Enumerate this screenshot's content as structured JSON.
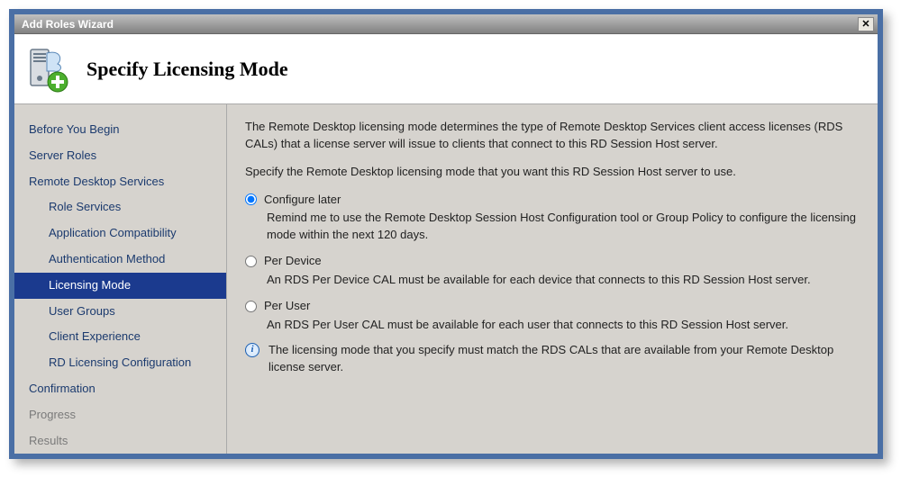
{
  "window": {
    "title": "Add Roles Wizard",
    "close": "✕"
  },
  "header": {
    "title": "Specify Licensing Mode"
  },
  "sidebar": {
    "items": [
      {
        "label": "Before You Begin",
        "child": false,
        "selected": false,
        "disabled": false
      },
      {
        "label": "Server Roles",
        "child": false,
        "selected": false,
        "disabled": false
      },
      {
        "label": "Remote Desktop Services",
        "child": false,
        "selected": false,
        "disabled": false
      },
      {
        "label": "Role Services",
        "child": true,
        "selected": false,
        "disabled": false
      },
      {
        "label": "Application Compatibility",
        "child": true,
        "selected": false,
        "disabled": false
      },
      {
        "label": "Authentication Method",
        "child": true,
        "selected": false,
        "disabled": false
      },
      {
        "label": "Licensing Mode",
        "child": true,
        "selected": true,
        "disabled": false
      },
      {
        "label": "User Groups",
        "child": true,
        "selected": false,
        "disabled": false
      },
      {
        "label": "Client Experience",
        "child": true,
        "selected": false,
        "disabled": false
      },
      {
        "label": "RD Licensing Configuration",
        "child": true,
        "selected": false,
        "disabled": false
      },
      {
        "label": "Confirmation",
        "child": false,
        "selected": false,
        "disabled": false
      },
      {
        "label": "Progress",
        "child": false,
        "selected": false,
        "disabled": true
      },
      {
        "label": "Results",
        "child": false,
        "selected": false,
        "disabled": true
      }
    ]
  },
  "content": {
    "intro1": "The Remote Desktop licensing mode determines the type of Remote Desktop Services client access licenses (RDS CALs) that a license server will issue to clients that connect to this RD Session Host server.",
    "intro2": "Specify the Remote Desktop licensing mode that you want this RD Session Host server to use.",
    "options": [
      {
        "label": "Configure later",
        "desc": "Remind me to use the Remote Desktop Session Host Configuration tool or Group Policy to configure the licensing mode within the next 120 days.",
        "selected": true
      },
      {
        "label": "Per Device",
        "desc": "An RDS Per Device CAL must be available for each device that connects to this RD Session Host server.",
        "selected": false
      },
      {
        "label": "Per User",
        "desc": "An RDS Per User CAL must be available for each user that connects to this RD Session Host server.",
        "selected": false
      }
    ],
    "info": "The licensing mode that you specify must match the RDS CALs that are available from your Remote Desktop license server."
  }
}
